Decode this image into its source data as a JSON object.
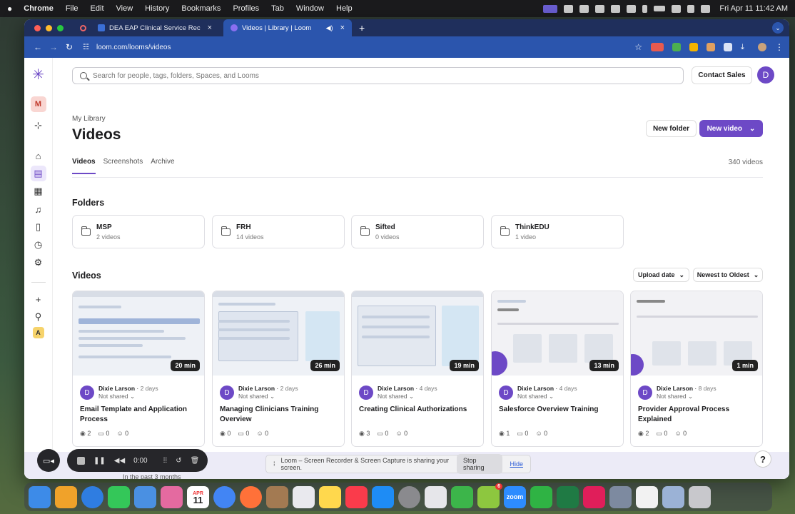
{
  "menubar": {
    "app": "Chrome",
    "items": [
      "File",
      "Edit",
      "View",
      "History",
      "Bookmarks",
      "Profiles",
      "Tab",
      "Window",
      "Help"
    ],
    "datetime": "Fri Apr 11  11:42 AM"
  },
  "browser": {
    "tabs": [
      {
        "label": "DEA EAP Clinical Service Rec",
        "favicon_color": "#3b6fd6"
      },
      {
        "label": "Videos | Library | Loom",
        "favicon_color": "#6d49c6"
      }
    ],
    "url": "loom.com/looms/videos",
    "new_tab": "+"
  },
  "app": {
    "search_placeholder": "Search for people, tags, folders, Spaces, and Looms",
    "contact_sales": "Contact Sales",
    "user_initial": "D",
    "sidebar": {
      "workspace_initial": "M",
      "bottom_initial": "A"
    },
    "breadcrumb": "My Library",
    "title": "Videos",
    "new_folder": "New folder",
    "new_video": "New video",
    "tabs": [
      "Videos",
      "Screenshots",
      "Archive"
    ],
    "video_count": "340 videos",
    "folders_heading": "Folders",
    "folders": [
      {
        "name": "MSP",
        "count": "2 videos"
      },
      {
        "name": "FRH",
        "count": "14 videos"
      },
      {
        "name": "Sifted",
        "count": "0 videos"
      },
      {
        "name": "ThinkEDU",
        "count": "1 video"
      }
    ],
    "videos_heading": "Videos",
    "sort_date": "Upload date",
    "sort_order": "Newest to Oldest",
    "videos": [
      {
        "duration": "20 min",
        "author": "Dixie Larson",
        "ago": "2 days",
        "shared": "Not shared",
        "title": "Email Template and Application Process",
        "views": "2",
        "comments": "0",
        "reactions": "0"
      },
      {
        "duration": "26 min",
        "author": "Dixie Larson",
        "ago": "2 days",
        "shared": "Not shared",
        "title": "Managing Clinicians Training Overview",
        "views": "0",
        "comments": "0",
        "reactions": "0"
      },
      {
        "duration": "19 min",
        "author": "Dixie Larson",
        "ago": "4 days",
        "shared": "Not shared",
        "title": "Creating Clinical Authorizations",
        "views": "3",
        "comments": "0",
        "reactions": "0"
      },
      {
        "duration": "13 min",
        "author": "Dixie Larson",
        "ago": "4 days",
        "shared": "Not shared",
        "title": "Salesforce Overview Training",
        "views": "1",
        "comments": "0",
        "reactions": "0"
      },
      {
        "duration": "1 min",
        "author": "Dixie Larson",
        "ago": "8 days",
        "shared": "Not shared",
        "title": "Provider Approval Process Explained",
        "views": "2",
        "comments": "0",
        "reactions": "0"
      }
    ],
    "banner_text": "In the past 3 months",
    "help": "?"
  },
  "recorder": {
    "time": "0:00"
  },
  "share_bar": {
    "message": "Loom – Screen Recorder & Screen Capture is sharing your screen.",
    "stop": "Stop sharing",
    "hide": "Hide"
  },
  "dock": {
    "calendar_month": "APR",
    "calendar_day": "11",
    "zoom": "zoom",
    "badge": "6",
    "colors": [
      "#3d8be8",
      "#f0a22a",
      "#2f7de1",
      "#34c759",
      "#4a90e2",
      "#e46aa0",
      "#ffffff",
      "#4285f4",
      "#ff7139",
      "#a37a52",
      "#e9e9ee",
      "#ffd84d",
      "#fa3b4b",
      "#1e8cf5",
      "#8a8a8e",
      "#e6e6ea",
      "#3cb54a",
      "#8dc73f",
      "#2d8cff",
      "#2fb344",
      "#1f7a44",
      "#e01e5a",
      "#7d8aa0",
      "#f2f2f2",
      "#9bb2d6",
      "#c8c8cc"
    ]
  }
}
